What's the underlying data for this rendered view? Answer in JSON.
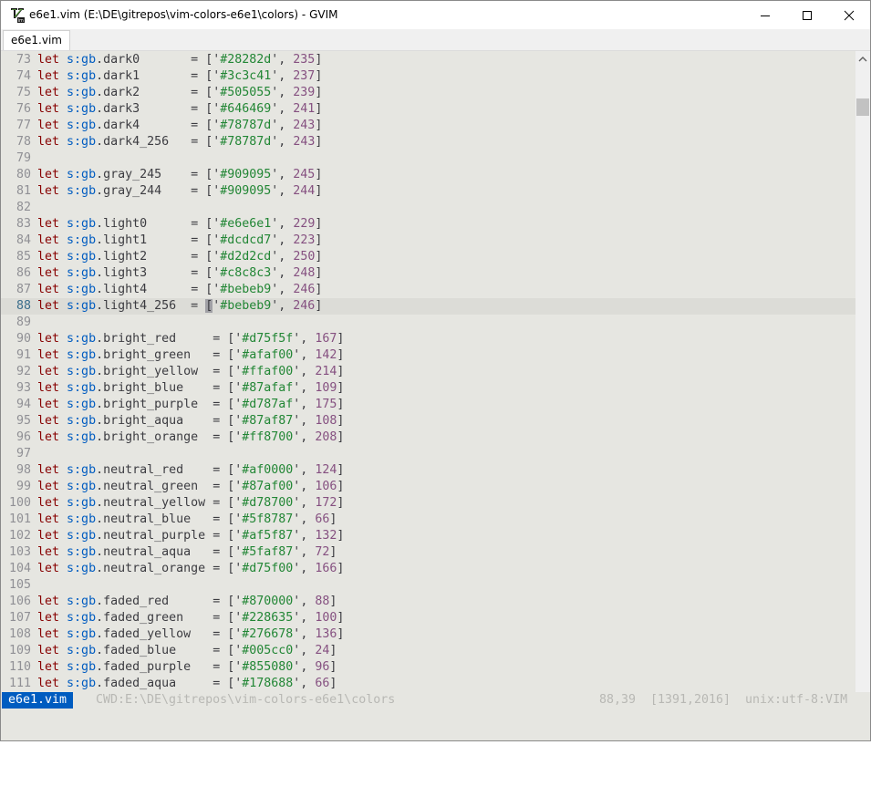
{
  "window": {
    "title": "e6e1.vim (E:\\DE\\gitrepos\\vim-colors-e6e1\\colors) - GVIM",
    "icon": "vim-icon"
  },
  "tabs": [
    {
      "label": "e6e1.vim",
      "active": true
    }
  ],
  "editor": {
    "lines": [
      {
        "n": "73",
        "var": "dark0",
        "pad": "       ",
        "hex": "#28282d",
        "num": "235"
      },
      {
        "n": "74",
        "var": "dark1",
        "pad": "       ",
        "hex": "#3c3c41",
        "num": "237"
      },
      {
        "n": "75",
        "var": "dark2",
        "pad": "       ",
        "hex": "#505055",
        "num": "239"
      },
      {
        "n": "76",
        "var": "dark3",
        "pad": "       ",
        "hex": "#646469",
        "num": "241"
      },
      {
        "n": "77",
        "var": "dark4",
        "pad": "       ",
        "hex": "#78787d",
        "num": "243"
      },
      {
        "n": "78",
        "var": "dark4_256",
        "pad": "   ",
        "hex": "#78787d",
        "num": "243"
      },
      {
        "n": "79",
        "blank": true
      },
      {
        "n": "80",
        "var": "gray_245",
        "pad": "    ",
        "hex": "#909095",
        "num": "245"
      },
      {
        "n": "81",
        "var": "gray_244",
        "pad": "    ",
        "hex": "#909095",
        "num": "244"
      },
      {
        "n": "82",
        "blank": true
      },
      {
        "n": "83",
        "var": "light0",
        "pad": "      ",
        "hex": "#e6e6e1",
        "num": "229"
      },
      {
        "n": "84",
        "var": "light1",
        "pad": "      ",
        "hex": "#dcdcd7",
        "num": "223"
      },
      {
        "n": "85",
        "var": "light2",
        "pad": "      ",
        "hex": "#d2d2cd",
        "num": "250"
      },
      {
        "n": "86",
        "var": "light3",
        "pad": "      ",
        "hex": "#c8c8c3",
        "num": "248"
      },
      {
        "n": "87",
        "var": "light4",
        "pad": "      ",
        "hex": "#bebeb9",
        "num": "246"
      },
      {
        "n": "88",
        "var": "light4_256",
        "pad": "  ",
        "hex": "#bebeb9",
        "num": "246",
        "current": true
      },
      {
        "n": "89",
        "blank": true
      },
      {
        "n": "90",
        "var": "bright_red",
        "pad": "     ",
        "hex": "#d75f5f",
        "num": "167"
      },
      {
        "n": "91",
        "var": "bright_green",
        "pad": "   ",
        "hex": "#afaf00",
        "num": "142"
      },
      {
        "n": "92",
        "var": "bright_yellow",
        "pad": "  ",
        "hex": "#ffaf00",
        "num": "214"
      },
      {
        "n": "93",
        "var": "bright_blue",
        "pad": "    ",
        "hex": "#87afaf",
        "num": "109"
      },
      {
        "n": "94",
        "var": "bright_purple",
        "pad": "  ",
        "hex": "#d787af",
        "num": "175"
      },
      {
        "n": "95",
        "var": "bright_aqua",
        "pad": "    ",
        "hex": "#87af87",
        "num": "108"
      },
      {
        "n": "96",
        "var": "bright_orange",
        "pad": "  ",
        "hex": "#ff8700",
        "num": "208"
      },
      {
        "n": "97",
        "blank": true
      },
      {
        "n": "98",
        "var": "neutral_red",
        "pad": "    ",
        "hex": "#af0000",
        "num": "124"
      },
      {
        "n": "99",
        "var": "neutral_green",
        "pad": "  ",
        "hex": "#87af00",
        "num": "106"
      },
      {
        "n": "100",
        "var": "neutral_yellow",
        "pad": " ",
        "hex": "#d78700",
        "num": "172"
      },
      {
        "n": "101",
        "var": "neutral_blue",
        "pad": "   ",
        "hex": "#5f8787",
        "num": "66"
      },
      {
        "n": "102",
        "var": "neutral_purple",
        "pad": " ",
        "hex": "#af5f87",
        "num": "132"
      },
      {
        "n": "103",
        "var": "neutral_aqua",
        "pad": "   ",
        "hex": "#5faf87",
        "num": "72"
      },
      {
        "n": "104",
        "var": "neutral_orange",
        "pad": " ",
        "hex": "#d75f00",
        "num": "166"
      },
      {
        "n": "105",
        "blank": true
      },
      {
        "n": "106",
        "var": "faded_red",
        "pad": "      ",
        "hex": "#870000",
        "num": "88"
      },
      {
        "n": "107",
        "var": "faded_green",
        "pad": "    ",
        "hex": "#228635",
        "num": "100"
      },
      {
        "n": "108",
        "var": "faded_yellow",
        "pad": "   ",
        "hex": "#276678",
        "num": "136"
      },
      {
        "n": "109",
        "var": "faded_blue",
        "pad": "     ",
        "hex": "#005cc0",
        "num": "24"
      },
      {
        "n": "110",
        "var": "faded_purple",
        "pad": "   ",
        "hex": "#855080",
        "num": "96"
      },
      {
        "n": "111",
        "var": "faded_aqua",
        "pad": "     ",
        "hex": "#178688",
        "num": "66"
      }
    ]
  },
  "statusline": {
    "file": "e6e1.vim",
    "cwd": "CWD:E:\\DE\\gitrepos\\vim-colors-e6e1\\colors",
    "position": "88,39",
    "range": "[1391,2016]",
    "encoding": "unix:utf-8:VIM"
  },
  "colors": {
    "background": "#e6e6e1",
    "cursorline": "#dcdcd7",
    "keyword": "#870000",
    "scope": "#005cc0",
    "string": "#228635",
    "number": "#855080",
    "line_number": "#909095",
    "status_accent": "#005cc0"
  }
}
